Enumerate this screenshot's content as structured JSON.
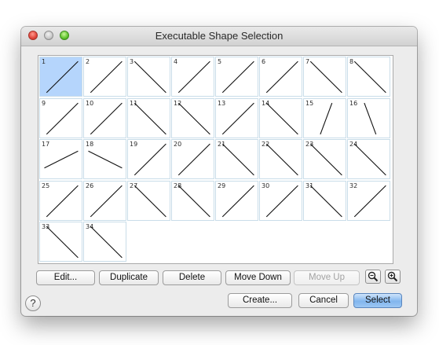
{
  "window": {
    "title": "Executable Shape Selection"
  },
  "shapes": [
    {
      "label": "1",
      "selected": true,
      "line": [
        0.15,
        0.88,
        0.88,
        0.1
      ]
    },
    {
      "label": "2",
      "line": [
        0.15,
        0.88,
        0.88,
        0.1
      ]
    },
    {
      "label": "3",
      "line": [
        0.15,
        0.1,
        0.88,
        0.88
      ]
    },
    {
      "label": "4",
      "line": [
        0.15,
        0.88,
        0.88,
        0.1
      ]
    },
    {
      "label": "5",
      "line": [
        0.15,
        0.88,
        0.88,
        0.1
      ]
    },
    {
      "label": "6",
      "line": [
        0.15,
        0.88,
        0.88,
        0.1
      ]
    },
    {
      "label": "7",
      "line": [
        0.15,
        0.1,
        0.88,
        0.88
      ]
    },
    {
      "label": "8",
      "line": [
        0.15,
        0.1,
        0.88,
        0.88
      ]
    },
    {
      "label": "9",
      "line": [
        0.15,
        0.88,
        0.88,
        0.1
      ]
    },
    {
      "label": "10",
      "line": [
        0.15,
        0.88,
        0.88,
        0.1
      ]
    },
    {
      "label": "11",
      "line": [
        0.15,
        0.1,
        0.88,
        0.88
      ]
    },
    {
      "label": "12",
      "line": [
        0.15,
        0.1,
        0.88,
        0.88
      ]
    },
    {
      "label": "13",
      "line": [
        0.15,
        0.88,
        0.88,
        0.1
      ]
    },
    {
      "label": "14",
      "line": [
        0.15,
        0.1,
        0.88,
        0.88
      ]
    },
    {
      "label": "15",
      "line": [
        0.38,
        0.88,
        0.65,
        0.1
      ]
    },
    {
      "label": "16",
      "line": [
        0.38,
        0.1,
        0.65,
        0.88
      ]
    },
    {
      "label": "17",
      "line": [
        0.1,
        0.7,
        0.88,
        0.28
      ]
    },
    {
      "label": "18",
      "line": [
        0.1,
        0.28,
        0.88,
        0.7
      ]
    },
    {
      "label": "19",
      "line": [
        0.15,
        0.88,
        0.88,
        0.1
      ]
    },
    {
      "label": "20",
      "line": [
        0.15,
        0.88,
        0.88,
        0.1
      ]
    },
    {
      "label": "21",
      "line": [
        0.15,
        0.1,
        0.88,
        0.88
      ]
    },
    {
      "label": "22",
      "line": [
        0.15,
        0.1,
        0.88,
        0.88
      ]
    },
    {
      "label": "23",
      "line": [
        0.15,
        0.1,
        0.88,
        0.88
      ]
    },
    {
      "label": "24",
      "line": [
        0.15,
        0.1,
        0.88,
        0.88
      ]
    },
    {
      "label": "25",
      "line": [
        0.15,
        0.88,
        0.88,
        0.1
      ]
    },
    {
      "label": "26",
      "line": [
        0.15,
        0.88,
        0.88,
        0.1
      ]
    },
    {
      "label": "27",
      "line": [
        0.15,
        0.1,
        0.88,
        0.88
      ]
    },
    {
      "label": "28",
      "line": [
        0.15,
        0.1,
        0.88,
        0.88
      ]
    },
    {
      "label": "29",
      "line": [
        0.15,
        0.88,
        0.88,
        0.1
      ]
    },
    {
      "label": "30",
      "line": [
        0.15,
        0.88,
        0.88,
        0.1
      ]
    },
    {
      "label": "31",
      "line": [
        0.15,
        0.1,
        0.88,
        0.88
      ]
    },
    {
      "label": "32",
      "line": [
        0.15,
        0.88,
        0.88,
        0.1
      ]
    },
    {
      "label": "33",
      "line": [
        0.15,
        0.1,
        0.88,
        0.88
      ]
    },
    {
      "label": "34",
      "line": [
        0.15,
        0.1,
        0.88,
        0.88
      ]
    }
  ],
  "actions": {
    "edit": "Edit...",
    "duplicate": "Duplicate",
    "delete": "Delete",
    "move_down": "Move Down",
    "move_up": "Move Up"
  },
  "footer": {
    "help": "?",
    "create": "Create...",
    "cancel": "Cancel",
    "select": "Select"
  },
  "icons": {
    "zoom_out": "zoom-out-icon",
    "zoom_in": "zoom-in-icon",
    "help": "help-icon"
  },
  "colors": {
    "selection": "#b5d5fc",
    "default_button": "#82b6ee",
    "cell_border": "#c9dde9"
  }
}
